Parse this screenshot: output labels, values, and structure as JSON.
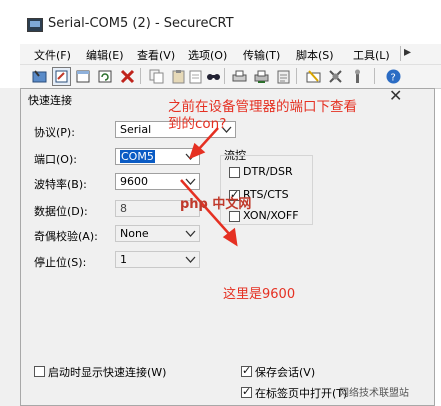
{
  "window": {
    "title": "Serial-COM5 (2) - SecureCRT"
  },
  "menu": [
    {
      "name": "menu-file",
      "label": "文件(F)"
    },
    {
      "name": "menu-edit",
      "label": "编辑(E)"
    },
    {
      "name": "menu-view",
      "label": "查看(V)"
    },
    {
      "name": "menu-options",
      "label": "选项(O)"
    },
    {
      "name": "menu-transfer",
      "label": "传输(T)"
    },
    {
      "name": "menu-script",
      "label": "脚本(S)"
    },
    {
      "name": "menu-tools",
      "label": "工具(L)"
    }
  ],
  "toolbar_icons": [
    "connect-icon",
    "quick-connect-icon",
    "session-tab-icon",
    "reconnect-icon",
    "disconnect-icon",
    "copy-icon",
    "paste-icon",
    "copy-paste-icon",
    "find-icon",
    "print-icon",
    "print-setup-icon",
    "log-icon",
    "session-options-icon",
    "global-options-icon",
    "keymap-icon",
    "help-icon"
  ],
  "dialog": {
    "title": "快速连接",
    "protocol": {
      "label": "协议(P):",
      "value": "Serial"
    },
    "port": {
      "label": "端口(O):",
      "value": "COM5"
    },
    "baud": {
      "label": "波特率(B):",
      "value": "9600"
    },
    "databits": {
      "label": "数据位(D):",
      "value": "8"
    },
    "parity": {
      "label": "奇偶校验(A):",
      "value": "None"
    },
    "stopbits": {
      "label": "停止位(S):",
      "value": "1"
    },
    "flow": {
      "title": "流控",
      "dtr": {
        "label": "DTR/DSR",
        "checked": false
      },
      "rts": {
        "label": "RTS/CTS",
        "checked": true
      },
      "xon": {
        "label": "XON/XOFF",
        "checked": false
      }
    },
    "startup": {
      "label": "启动时显示快速连接(W)",
      "checked": false
    },
    "save_session": {
      "label": "保存会话(V)",
      "checked": true
    },
    "open_tab": {
      "label": "在标签页中打开(T)",
      "checked": true
    }
  },
  "annotations": {
    "line1": "之前在设备管理器的端口下查看",
    "line2": "到的con?",
    "note": "这里是9600"
  },
  "watermarks": {
    "php": "php 中文网",
    "corner": "网络技术联盟站"
  }
}
